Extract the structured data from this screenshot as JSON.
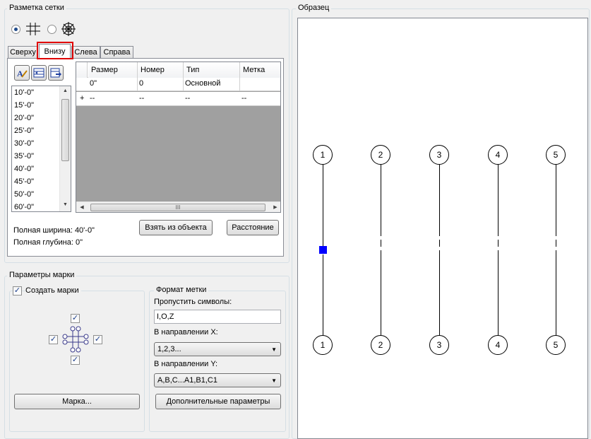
{
  "grid_group": {
    "title": "Разметка сетки",
    "tabs": [
      {
        "label": "Сверху"
      },
      {
        "label": "Внизу"
      },
      {
        "label": "Слева"
      },
      {
        "label": "Справа"
      }
    ],
    "spacing_list": [
      "10'-0\"",
      "15'-0\"",
      "20'-0\"",
      "25'-0\"",
      "30'-0\"",
      "35'-0\"",
      "40'-0\"",
      "45'-0\"",
      "50'-0\"",
      "60'-0\""
    ],
    "table": {
      "columns": [
        "Размер",
        "Номер",
        "Тип",
        "Метка"
      ],
      "rows": [
        {
          "marker": "",
          "size": "0\"",
          "number": "0",
          "type": "Основной",
          "label": ""
        },
        {
          "marker": "+",
          "size": "--",
          "number": "--",
          "type": "--",
          "label": "--"
        }
      ],
      "scroll_grip": "III"
    },
    "total_width": "Полная ширина: 40'-0\"",
    "total_depth": "Полная глубина: 0\"",
    "take_from_object": "Взять из объекта",
    "distance_button": "Расстояние"
  },
  "preview_group": {
    "title": "Образец",
    "bubbles_top": [
      "1",
      "2",
      "3",
      "4",
      "5"
    ],
    "bubbles_bottom": [
      "1",
      "2",
      "3",
      "4",
      "5"
    ],
    "selection_color": "#0000ff"
  },
  "label_params": {
    "title": "Параметры марки",
    "create_labels": "Создать марки",
    "mark_button": "Марка...",
    "format_title": "Формат метки",
    "skip_chars_label": "Пропустить символы:",
    "skip_chars_value": "I,O,Z",
    "x_dir_label": "В направлении X:",
    "x_dir_value": "1,2,3...",
    "y_dir_label": "В направлении Y:",
    "y_dir_value": "A,B,C...A1,B1,C1",
    "more_params": "Дополнительные параметры"
  },
  "colors": {
    "highlight_border": "#e00000",
    "dialog_bg": "#f0f0f0",
    "table_empty_bg": "#a0a0a0"
  }
}
